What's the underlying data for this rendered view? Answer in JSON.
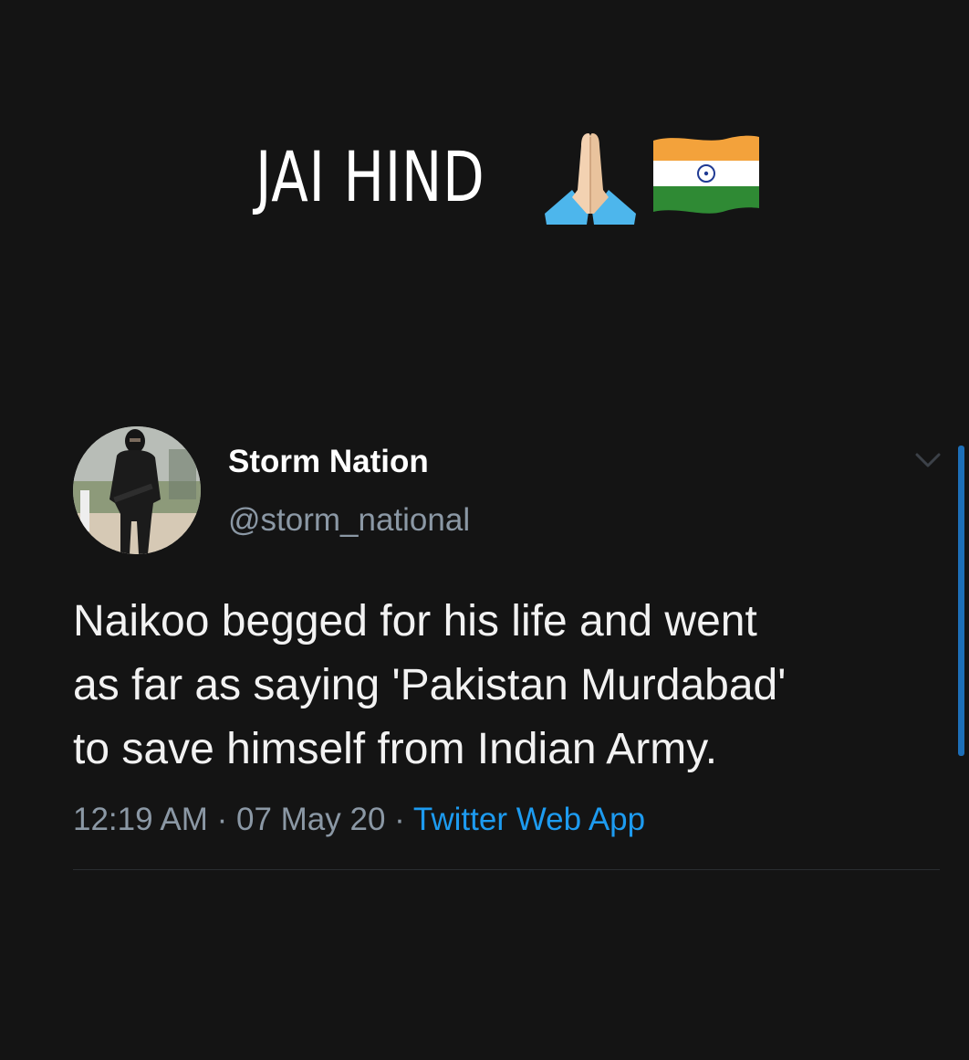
{
  "banner": {
    "text": "JAI HIND",
    "emoji_icons": [
      "folded-hands-icon",
      "india-flag-icon"
    ]
  },
  "tweet": {
    "display_name": "Storm Nation",
    "handle": "@storm_national",
    "body_lines": [
      "Naikoo begged for his life and went",
      "as far as saying 'Pakistan Murdabad'",
      "to save himself from Indian Army."
    ],
    "time": "12:19 AM",
    "separator": " · ",
    "date": "07 May 20",
    "source": "Twitter Web App"
  },
  "colors": {
    "background": "#141414",
    "text_primary": "#ffffff",
    "text_secondary": "#8b98a5",
    "link": "#1d9bf0",
    "scrollbar": "#1d6fb8"
  }
}
